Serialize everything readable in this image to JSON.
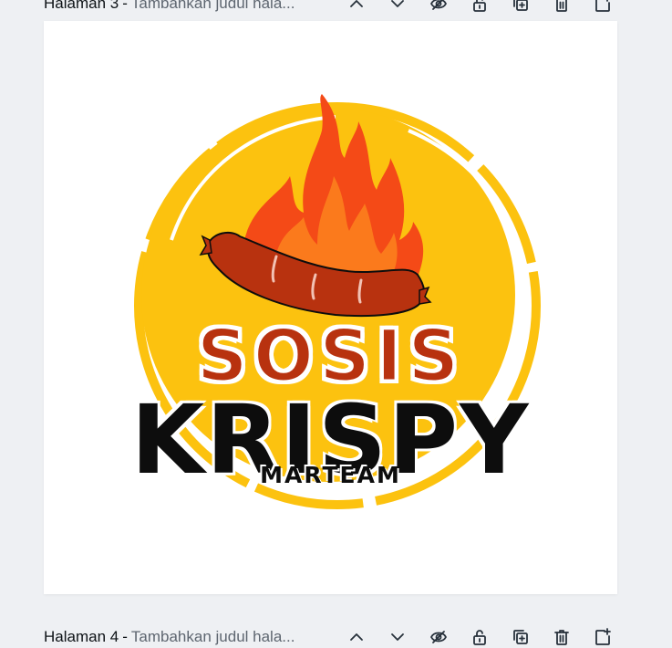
{
  "pages": [
    {
      "label": "Halaman 3",
      "separator": "-",
      "title_placeholder": "Tambahkan judul hala..."
    },
    {
      "label": "Halaman 4",
      "separator": "-",
      "title_placeholder": "Tambahkan judul hala..."
    }
  ],
  "toolbar_icons": [
    "chevron-up-icon",
    "chevron-down-icon",
    "eye-icon",
    "lock-icon",
    "duplicate-icon",
    "trash-icon",
    "add-page-icon"
  ],
  "logo": {
    "line1": "SOSIS",
    "line2": "KRISPY",
    "line3": "MARTEAM",
    "colors": {
      "sun": "#fcc20f",
      "flame_outer": "#f44a17",
      "flame_inner": "#fb7a1c",
      "sausage": "#b8320f",
      "text_dark": "#0d0d0d"
    }
  }
}
